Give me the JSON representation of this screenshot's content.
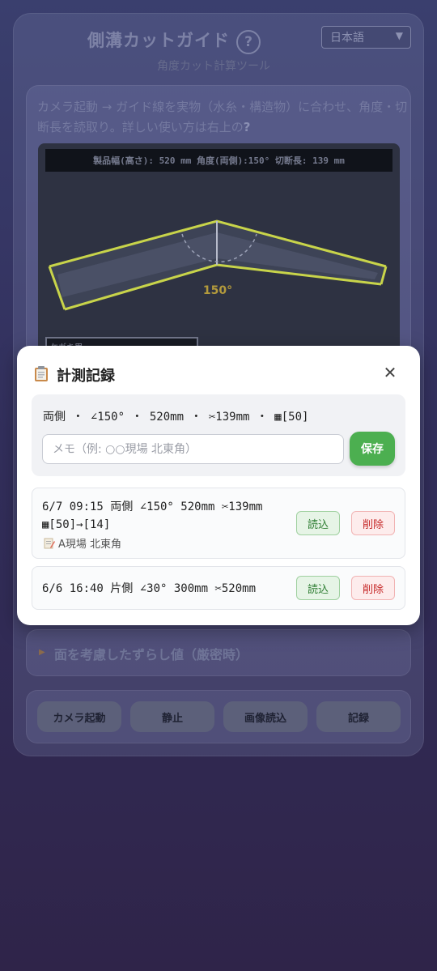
{
  "app": {
    "title": "側溝カットガイド",
    "help_label": "?",
    "language": "日本語",
    "subtitle": "角度カット計算ツール"
  },
  "guide": {
    "instructions": "カメラ起動 → ガイド線を実物（水糸・構造物）に合わせ、角度・切断長を読取り。詳しい使い方は右上の",
    "instructions_mark": "?",
    "readout": "製品幅(高さ): 520 mm  角度(両側):150°  切断長: 139 mm",
    "angle_label": "150°",
    "overlay_label": "ケガキ用"
  },
  "accordion": {
    "label": "面を考慮したずらし値（厳密時）",
    "caret_icon": "caret-right-icon"
  },
  "controls": {
    "camera": "カメラ起動",
    "freeze": "静止",
    "load_image": "画像読込",
    "record": "記録"
  },
  "modal": {
    "icon": "clipboard-icon",
    "title": "計測記録",
    "close_label": "✕",
    "current_summary": "両側 ・ ∠150° ・ 520mm ・ ✂139mm ・ ▦[50]",
    "memo_placeholder": "メモ（例: ○○現場 北東角）",
    "memo_value": "",
    "save_label": "保存",
    "records": [
      {
        "line1": "6/7 09:15 両側 ∠150° 520mm ✂139mm",
        "line2": "▦[50]→[14]",
        "memo": "A現場 北東角",
        "load_label": "読込",
        "delete_label": "削除"
      },
      {
        "line1": "6/6 16:40 片側 ∠30° 300mm ✂520mm",
        "load_label": "読込",
        "delete_label": "削除"
      }
    ]
  },
  "colors": {
    "save_green": "#4caf50",
    "delete_red": "#c62828",
    "load_green": "#2e7d32",
    "guide_line": "#c8d44a"
  }
}
